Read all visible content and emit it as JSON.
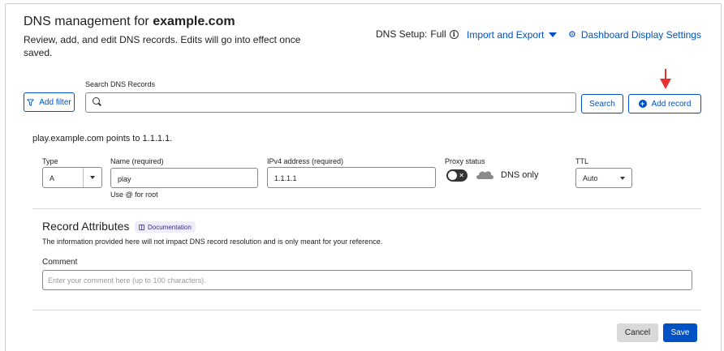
{
  "header": {
    "title_prefix": "DNS management for ",
    "domain": "example.com",
    "description": "Review, add, and edit DNS records. Edits will go into effect once saved.",
    "setup_label": "DNS Setup:",
    "setup_value": "Full",
    "import_export_label": "Import and Export",
    "dashboard_settings_label": "Dashboard Display Settings"
  },
  "toolbar": {
    "add_filter_label": "Add filter",
    "search_label": "Search DNS Records",
    "search_value": "",
    "search_button_label": "Search",
    "add_record_label": "Add record"
  },
  "record": {
    "summary_name": "play.example.com",
    "summary_points": " points to ",
    "summary_target": "1.1.1.1.",
    "type_label": "Type",
    "type_value": "A",
    "name_label": "Name (required)",
    "name_value": "play",
    "name_hint": "Use @ for root",
    "ip_label": "IPv4 address (required)",
    "ip_value": "1.1.1.1",
    "proxy_label": "Proxy status",
    "proxy_value": "DNS only",
    "ttl_label": "TTL",
    "ttl_value": "Auto"
  },
  "attributes": {
    "title": "Record Attributes",
    "doc_label": "Documentation",
    "description": "The information provided here will not impact DNS record resolution and is only meant for your reference.",
    "comment_label": "Comment",
    "comment_value": "",
    "comment_placeholder": "Enter your comment here (up to 100 characters)."
  },
  "actions": {
    "cancel_label": "Cancel",
    "save_label": "Save"
  },
  "colors": {
    "accent": "#0051c3",
    "annotation_arrow": "#e8322f",
    "cancel_bg": "#d9d9d9"
  }
}
